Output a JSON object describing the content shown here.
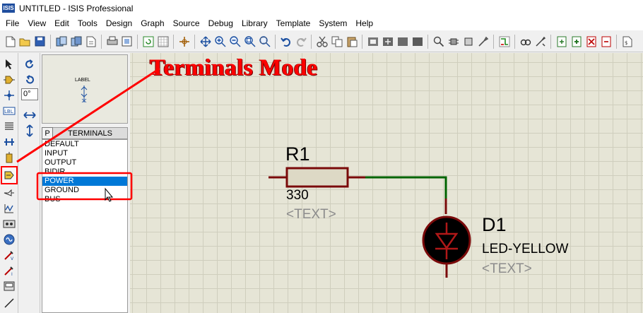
{
  "window": {
    "app_icon_text": "ISIS",
    "title": "UNTITLED - ISIS Professional"
  },
  "menu": [
    "File",
    "View",
    "Edit",
    "Tools",
    "Design",
    "Graph",
    "Source",
    "Debug",
    "Library",
    "Template",
    "System",
    "Help"
  ],
  "preview": {
    "label": "LABEL"
  },
  "rotation": {
    "angle": "0°"
  },
  "selector": {
    "p_button": "P",
    "title": "TERMINALS",
    "items": [
      "DEFAULT",
      "INPUT",
      "OUTPUT",
      "BIDIR",
      "POWER",
      "GROUND",
      "BUS"
    ],
    "selected": "POWER"
  },
  "schematic": {
    "resistor": {
      "ref": "R1",
      "value": "330",
      "text": "<TEXT>"
    },
    "led": {
      "ref": "D1",
      "value": "LED-YELLOW",
      "text": "<TEXT>"
    }
  },
  "annotation": {
    "title": "Terminals Mode",
    "color": "#ff0000"
  },
  "colors": {
    "wire": "#006400",
    "component": "#7a0a0a",
    "canvas": "#e6e5d6",
    "selection": "#0078d7"
  }
}
